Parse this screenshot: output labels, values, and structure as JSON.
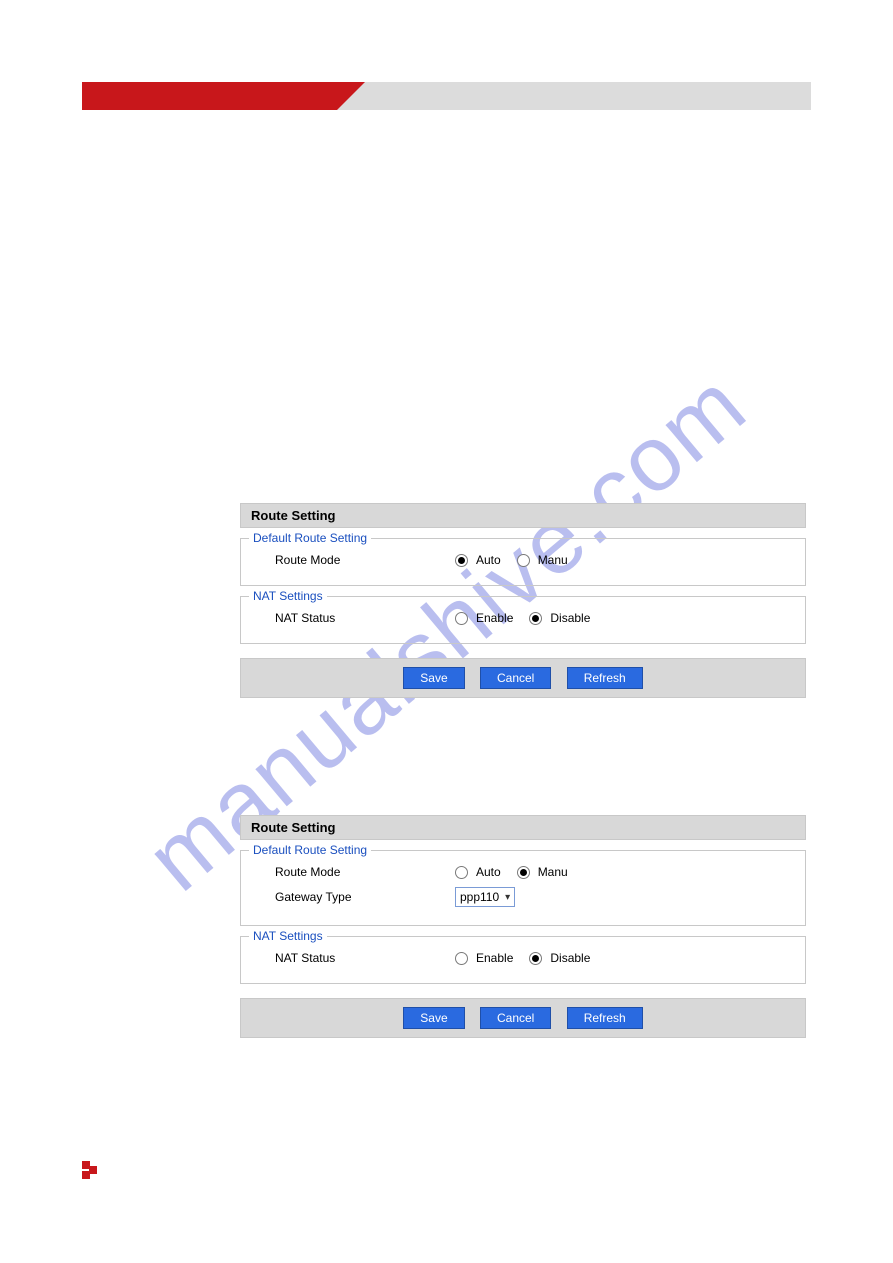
{
  "watermark": "manualshive.com",
  "panel1": {
    "title": "Route Setting",
    "default_route_legend": "Default Route Setting",
    "route_mode_label": "Route Mode",
    "route_mode_opt_auto": "Auto",
    "route_mode_opt_manu": "Manu",
    "nat_legend": "NAT Settings",
    "nat_status_label": "NAT Status",
    "nat_opt_enable": "Enable",
    "nat_opt_disable": "Disable",
    "btn_save": "Save",
    "btn_cancel": "Cancel",
    "btn_refresh": "Refresh"
  },
  "panel2": {
    "title": "Route Setting",
    "default_route_legend": "Default Route Setting",
    "route_mode_label": "Route Mode",
    "route_mode_opt_auto": "Auto",
    "route_mode_opt_manu": "Manu",
    "gateway_type_label": "Gateway Type",
    "gateway_type_value": "ppp110",
    "nat_legend": "NAT Settings",
    "nat_status_label": "NAT Status",
    "nat_opt_enable": "Enable",
    "nat_opt_disable": "Disable",
    "btn_save": "Save",
    "btn_cancel": "Cancel",
    "btn_refresh": "Refresh"
  }
}
